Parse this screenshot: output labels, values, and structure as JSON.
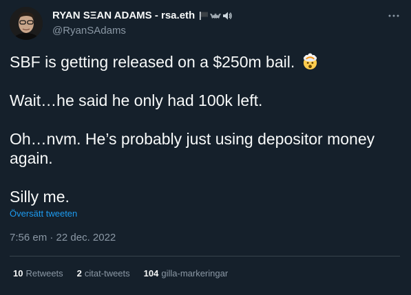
{
  "author": {
    "display_name": "RYAN SΞAN ADAMS - rsa.eth",
    "handle": "@RyanSAdams",
    "name_emojis": [
      "flag-icon",
      "bat-icon",
      "speaker-icon"
    ]
  },
  "tweet": {
    "paragraph1": "SBF is getting released on a $250m bail.",
    "paragraph2": "Wait…he said he only had 100k left.",
    "paragraph3": "Oh…nvm. He’s probably just using depositor money again.",
    "paragraph4": "Silly me.",
    "emoji": "exploding-head-icon",
    "translate_label": "Översätt tweeten",
    "timestamp": "7:56 em · 22 dec. 2022"
  },
  "stats": {
    "retweets_count": "10",
    "retweets_label": "Retweets",
    "quotes_count": "2",
    "quotes_label": "citat-tweets",
    "likes_count": "104",
    "likes_label": "gilla-markeringar"
  },
  "colors": {
    "background": "#15202b",
    "text": "#f7f9f9",
    "secondary": "#8b98a5",
    "link": "#1d9bf0",
    "divider": "#38444d"
  }
}
